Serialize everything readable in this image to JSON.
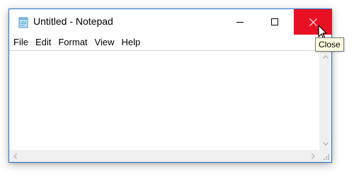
{
  "window": {
    "title": "Untitled - Notepad",
    "app_icon": "notepad-icon",
    "accent_color": "#2b78d0",
    "close_hover_color": "#e81123"
  },
  "caption_buttons": {
    "minimize_icon": "minimize-icon",
    "maximize_icon": "maximize-icon",
    "close_icon": "close-icon"
  },
  "menu": {
    "items": [
      "File",
      "Edit",
      "Format",
      "View",
      "Help"
    ]
  },
  "editor": {
    "content": ""
  },
  "tooltip": {
    "text": "Close"
  },
  "cursor": {
    "icon": "arrow-pointer-icon"
  }
}
